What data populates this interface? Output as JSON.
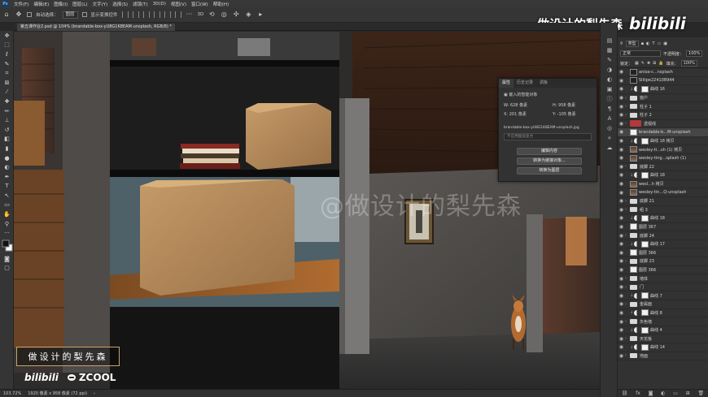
{
  "app": {
    "logo": "Ps"
  },
  "menu": [
    "文件(F)",
    "编辑(E)",
    "图像(I)",
    "图层(L)",
    "文字(Y)",
    "选择(S)",
    "滤镜(T)",
    "3D(D)",
    "视图(V)",
    "窗口(W)",
    "帮助(H)"
  ],
  "options": {
    "auto_select_label": "自动选择：",
    "auto_select_value": "图层",
    "transform_label": "显示变换控件"
  },
  "watermark": {
    "top_text": "做设计的梨先森",
    "top_logo": "bilibili",
    "center_text": "@做设计的梨先森",
    "box_text": "做设计的梨先森",
    "brand_bili": "bilibili",
    "brand_zcool": "ZCOOL"
  },
  "document": {
    "tab_title": "第五课作业2.psd @ 104% (brandable-box-yU8G1K8EAM-unsplash, RGB/8) *"
  },
  "status": {
    "zoom": "103.72%",
    "doc_size": "1920 像素 x 958 像素 (72 ppi)"
  },
  "layers_panel": {
    "kind_label": "类型",
    "blend_mode": "正常",
    "opacity_label": "不透明度：",
    "opacity_value": "100%",
    "lock_label": "锁定：",
    "fill_label": "填充：",
    "fill_value": "100%",
    "layers": [
      {
        "name": "anisa-c...nsplash",
        "type": "smart"
      },
      {
        "name": "Slilipe224108944",
        "type": "smart"
      },
      {
        "name": "曲线 16",
        "type": "adj"
      },
      {
        "name": "窗户",
        "type": "folder"
      },
      {
        "name": "柱子 1",
        "type": "folder"
      },
      {
        "name": "柱子 2",
        "type": "folder"
      },
      {
        "name": "透视线",
        "type": "folder-red"
      },
      {
        "name": "brandable-b...M-unsplash",
        "type": "smart",
        "selected": true
      },
      {
        "name": "曲线 18 拷贝",
        "type": "adj"
      },
      {
        "name": "wesley-ti...sh (1) 拷贝",
        "type": "photo"
      },
      {
        "name": "wesley-ting...splash (1)",
        "type": "photo"
      },
      {
        "name": "底脚 22",
        "type": "folder"
      },
      {
        "name": "曲线 18",
        "type": "adj"
      },
      {
        "name": "wesl...h 拷贝",
        "type": "photo"
      },
      {
        "name": "wesley-tin...Q-unsplash",
        "type": "photo"
      },
      {
        "name": "底脚 21",
        "type": "folder"
      },
      {
        "name": "组 3",
        "type": "folder"
      },
      {
        "name": "曲线 18",
        "type": "adj"
      },
      {
        "name": "图层 367",
        "type": "smart"
      },
      {
        "name": "底脚 24",
        "type": "folder"
      },
      {
        "name": "曲线 17",
        "type": "adj"
      },
      {
        "name": "图层 366",
        "type": "smart"
      },
      {
        "name": "底脚 23",
        "type": "folder"
      },
      {
        "name": "图层 366",
        "type": "smart"
      },
      {
        "name": "墙体",
        "type": "folder"
      },
      {
        "name": "门",
        "type": "folder"
      },
      {
        "name": "曲线 7",
        "type": "adj"
      },
      {
        "name": "金属面",
        "type": "folder"
      },
      {
        "name": "曲线 8",
        "type": "adj"
      },
      {
        "name": "灰色墙",
        "type": "folder"
      },
      {
        "name": "曲线 4",
        "type": "adj"
      },
      {
        "name": "天花板",
        "type": "folder"
      },
      {
        "name": "曲线 14",
        "type": "adj"
      },
      {
        "name": "地面",
        "type": "folder"
      }
    ]
  },
  "properties_panel": {
    "tabs": [
      "属性",
      "历史记录",
      "调板"
    ],
    "section_title": "嵌入的智能对象",
    "w_label": "W:",
    "w_value": "628 像素",
    "h_label": "H:",
    "h_value": "958 像素",
    "x_label": "X:",
    "x_value": "201 像素",
    "y_label": "Y:",
    "y_value": "-105 像素",
    "filename": "brandable-box-yU8G1K8EAM-unsplash.jpg",
    "layer_comp_placeholder": "不应用图层复合",
    "buttons": [
      "编辑内容",
      "转换为链接对象...",
      "转换为图层"
    ]
  }
}
